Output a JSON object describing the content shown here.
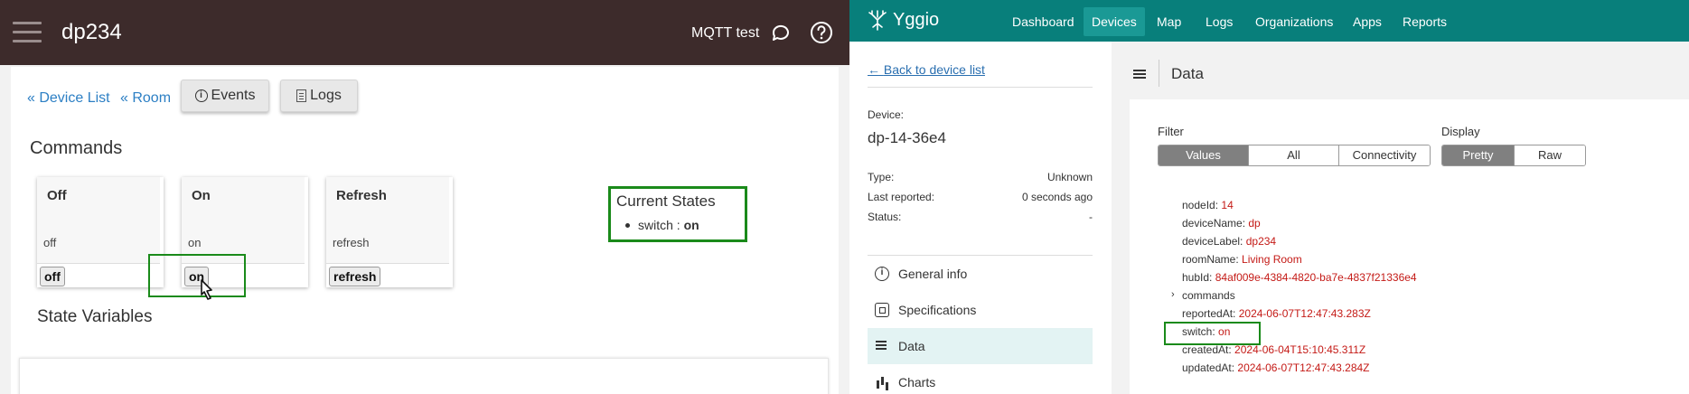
{
  "left": {
    "title": "dp234",
    "mqtt_label": "MQTT test",
    "breadcrumbs": {
      "device_list": "« Device List",
      "room": "« Room"
    },
    "tabs": {
      "events": "Events",
      "logs": "Logs"
    },
    "commands_title": "Commands",
    "commands": [
      {
        "name": "Off",
        "sub": "off",
        "button": "off"
      },
      {
        "name": "On",
        "sub": "on",
        "button": "on"
      },
      {
        "name": "Refresh",
        "sub": "refresh",
        "button": "refresh"
      }
    ],
    "current_states": {
      "title": "Current States",
      "item_key": "switch : ",
      "item_value": "on"
    },
    "state_variables_title": "State Variables",
    "icons": [
      "hamburger-icon",
      "chat-icon",
      "help-icon",
      "info-icon",
      "document-icon",
      "cursor-icon"
    ]
  },
  "right": {
    "brand": "Yggio",
    "nav": [
      {
        "label": "Dashboard",
        "active": false
      },
      {
        "label": "Devices",
        "active": true
      },
      {
        "label": "Map",
        "active": false
      },
      {
        "label": "Logs",
        "active": false
      },
      {
        "label": "Organizations",
        "active": false
      },
      {
        "label": "Apps",
        "active": false
      },
      {
        "label": "Reports",
        "active": false
      }
    ],
    "back_link": "Back to device list",
    "back_arrow": "←",
    "device_label": "Device:",
    "device_name": "dp-14-36e4",
    "info": {
      "type_label": "Type:",
      "type_value": "Unknown",
      "reported_label": "Last reported:",
      "reported_value": "0 seconds ago",
      "status_label": "Status:",
      "status_value": "-"
    },
    "menu": [
      "General info",
      "Specifications",
      "Data",
      "Charts"
    ],
    "main_title": "Data",
    "filter": {
      "label": "Filter",
      "options": [
        "Values",
        "All",
        "Connectivity"
      ],
      "selected": "Values"
    },
    "display": {
      "label": "Display",
      "options": [
        "Pretty",
        "Raw"
      ],
      "selected": "Pretty"
    },
    "data_rows": [
      {
        "key": "nodeId:",
        "value": "14"
      },
      {
        "key": "deviceName:",
        "value": "dp"
      },
      {
        "key": "deviceLabel:",
        "value": "dp234"
      },
      {
        "key": "roomName:",
        "value": "Living Room"
      },
      {
        "key": "hubId:",
        "value": "84af009e-4384-4820-ba7e-4837f21336e4"
      },
      {
        "key": "commands",
        "value": ""
      },
      {
        "key": "reportedAt:",
        "value": "2024-06-07T12:47:43.283Z"
      },
      {
        "key": "switch:",
        "value": "on"
      },
      {
        "key": "createdAt:",
        "value": "2024-06-04T15:10:45.311Z"
      },
      {
        "key": "updatedAt:",
        "value": "2024-06-07T12:47:43.284Z"
      }
    ],
    "accent_color": "#087f7b"
  }
}
